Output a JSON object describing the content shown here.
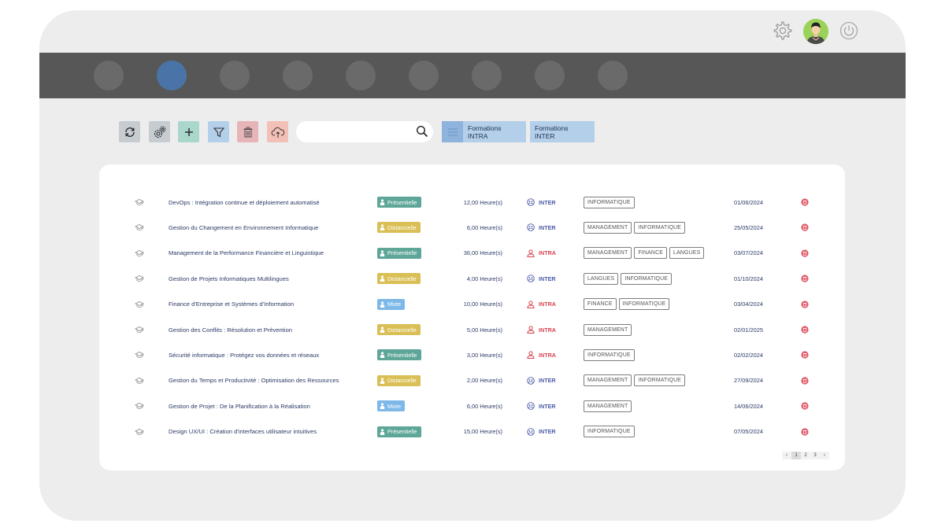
{
  "topbar": {
    "icons": {
      "settings": "gear-icon",
      "logout": "power-icon"
    },
    "avatar": "user-avatar"
  },
  "navbar": {
    "items": [
      "nav-item-1",
      "nav-item-2",
      "nav-item-3",
      "nav-item-4",
      "nav-item-5",
      "nav-item-6",
      "nav-item-7",
      "nav-item-8",
      "nav-item-9"
    ],
    "active_index": 1
  },
  "toolbar": {
    "buttons": [
      {
        "name": "refresh-button",
        "icon": "refresh-icon",
        "color": "#c7ccd1"
      },
      {
        "name": "settings-button",
        "icon": "gears-icon",
        "color": "#c7ccd1"
      },
      {
        "name": "add-button",
        "icon": "plus-icon",
        "color": "#a9d7cc"
      },
      {
        "name": "filter-button",
        "icon": "filter-icon",
        "color": "#b4cfea"
      },
      {
        "name": "delete-button",
        "icon": "trash-icon",
        "color": "#e7b4b8"
      },
      {
        "name": "upload-button",
        "icon": "cloud-upload-icon",
        "color": "#f3c0b7"
      }
    ],
    "search": {
      "value": "",
      "placeholder": ""
    },
    "tab_intra": "Formations INTRA",
    "tab_inter": "Formations INTER"
  },
  "modes": {
    "Présentielle": "#5da698",
    "Distancielle": "#d9bf55",
    "Mixte": "#7db8e8"
  },
  "type_colors": {
    "INTER": "#4a58a8",
    "INTRA": "#d7424f"
  },
  "rows": [
    {
      "title": "DevOps : Intégration continue et déploiement automatisé",
      "mode": "Présentielle",
      "duration": "12,00 Heure(s)",
      "type": "INTER",
      "tags": [
        "INFORMATIQUE"
      ],
      "date": "01/06/2024"
    },
    {
      "title": "Gestion du Changement en Environnement Informatique",
      "mode": "Distancielle",
      "duration": "6,00 Heure(s)",
      "type": "INTER",
      "tags": [
        "MANAGEMENT",
        "INFORMATIQUE"
      ],
      "date": "25/05/2024"
    },
    {
      "title": "Management de la Performance Financière et Linguistique",
      "mode": "Présentielle",
      "duration": "36,00 Heure(s)",
      "type": "INTRA",
      "tags": [
        "MANAGEMENT",
        "FINANCE",
        "LANGUES"
      ],
      "date": "03/07/2024"
    },
    {
      "title": "Gestion de Projets Informatiques Multilingues",
      "mode": "Distancielle",
      "duration": "4,00 Heure(s)",
      "type": "INTER",
      "tags": [
        "LANGUES",
        "INFORMATIQUE"
      ],
      "date": "01/10/2024"
    },
    {
      "title": "Finance d'Entreprise et Systèmes d'Information",
      "mode": "Mixte",
      "duration": "10,00 Heure(s)",
      "type": "INTRA",
      "tags": [
        "FINANCE",
        "INFORMATIQUE"
      ],
      "date": "03/04/2024"
    },
    {
      "title": "Gestion des Conflits : Résolution et Prévention",
      "mode": "Distancielle",
      "duration": "5,00 Heure(s)",
      "type": "INTRA",
      "tags": [
        "MANAGEMENT"
      ],
      "date": "02/01/2025"
    },
    {
      "title": "Sécurité informatique : Protégez vos données et réseaux",
      "mode": "Présentielle",
      "duration": "3,00 Heure(s)",
      "type": "INTRA",
      "tags": [
        "INFORMATIQUE"
      ],
      "date": "02/02/2024"
    },
    {
      "title": "Gestion du Temps et Productivité : Optimisation des Ressources",
      "mode": "Distancielle",
      "duration": "2,00 Heure(s)",
      "type": "INTER",
      "tags": [
        "MANAGEMENT",
        "INFORMATIQUE"
      ],
      "date": "27/09/2024"
    },
    {
      "title": "Gestion de Projet : De la Planification à la Réalisation",
      "mode": "Mixte",
      "duration": "6,00 Heure(s)",
      "type": "INTER",
      "tags": [
        "MANAGEMENT"
      ],
      "date": "14/06/2024"
    },
    {
      "title": "Design UX/UI : Création d'interfaces utilisateur intuitives",
      "mode": "Présentielle",
      "duration": "15,00 Heure(s)",
      "type": "INTER",
      "tags": [
        "INFORMATIQUE"
      ],
      "date": "07/05/2024"
    }
  ],
  "pagination": {
    "prev": "‹",
    "pages": [
      "1",
      "2",
      "3"
    ],
    "current": "1",
    "next": "›"
  }
}
